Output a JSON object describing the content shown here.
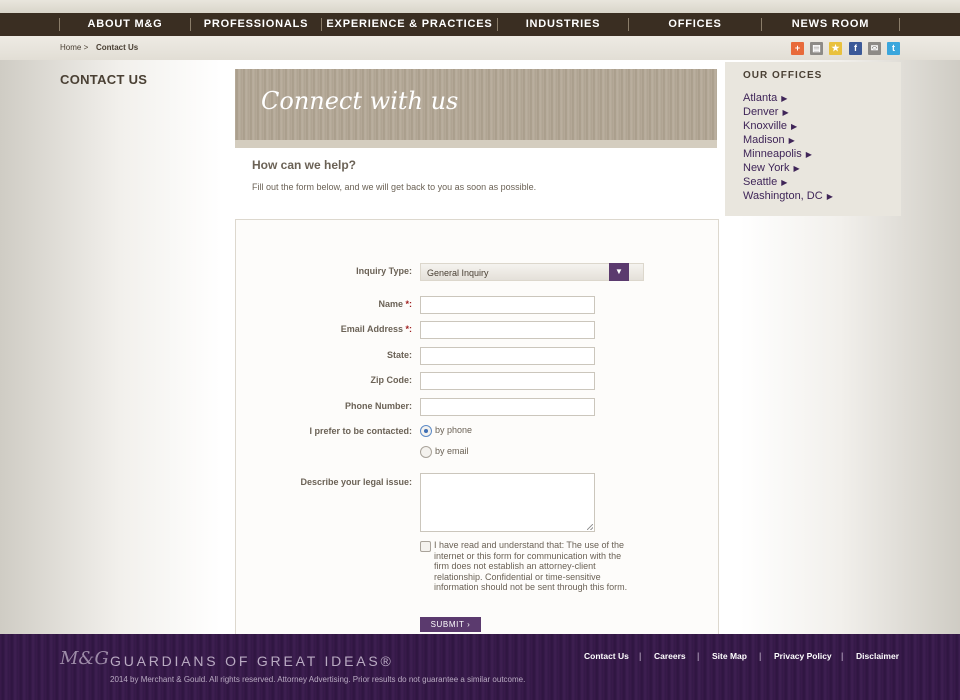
{
  "nav": {
    "items": [
      {
        "label": "ABOUT M&G"
      },
      {
        "label": "PROFESSIONALS"
      },
      {
        "label": "EXPERIENCE & PRACTICES"
      },
      {
        "label": "INDUSTRIES"
      },
      {
        "label": "OFFICES"
      },
      {
        "label": "NEWS ROOM"
      }
    ]
  },
  "breadcrumb": {
    "home": "Home >",
    "current": "Contact Us"
  },
  "share": {
    "icons": [
      "plus-share-icon",
      "print-icon",
      "favorite-star-icon",
      "facebook-icon",
      "email-icon",
      "twitter-icon"
    ],
    "colors": [
      "#e86a3a",
      "#8d8a86",
      "#e9c13d",
      "#3b5998",
      "#8d8a86",
      "#3aa6dc"
    ]
  },
  "page": {
    "section_title": "CONTACT US"
  },
  "hero": {
    "title": "Connect with us"
  },
  "help": {
    "title": "How can we help?",
    "text": "Fill out the form below, and we will get back to you as soon as possible."
  },
  "form": {
    "inquiry_label": "Inquiry Type:",
    "inquiry_value": "General Inquiry",
    "name_label": "Name ",
    "email_label": "Email Address ",
    "required_mark": "*:",
    "state_label": "State:",
    "zip_label": "Zip Code:",
    "phone_label": "Phone Number:",
    "contact_pref_label": "I prefer to be contacted:",
    "contact_options": [
      {
        "label": "by phone",
        "selected": true
      },
      {
        "label": "by email",
        "selected": false
      }
    ],
    "issue_label": "Describe your legal issue:",
    "disclaimer": "I have read and understand that: The use of the internet or this form for communication with the firm does not establish an attorney-client relationship. Confidential or time-sensitive information should not be sent through this form.",
    "submit_label": "SUBMIT"
  },
  "offices": {
    "title": "OUR OFFICES",
    "items": [
      "Atlanta",
      "Denver",
      "Knoxville",
      "Madison",
      "Minneapolis",
      "New York",
      "Seattle",
      "Washington, DC"
    ]
  },
  "footer": {
    "logo": "M&G",
    "tagline": "GUARDIANS OF GREAT IDEAS®",
    "copyright": "2014 by Merchant & Gould. All rights reserved. Attorney Advertising. Prior results do not guarantee a similar outcome.",
    "links": [
      "Contact Us",
      "Careers",
      "Site Map",
      "Privacy Policy",
      "Disclaimer"
    ]
  },
  "colors": {
    "nav_bg": "#3a2e22",
    "accent_purple": "#5b3a6e",
    "footer_purple": "#3a1b4c",
    "link_purple": "#3f2558"
  }
}
